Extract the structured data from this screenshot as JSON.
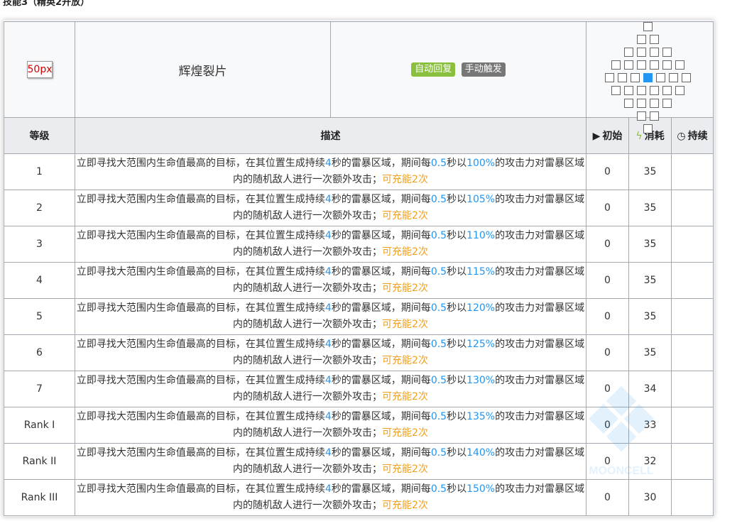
{
  "title": "技能3（精英2开放）",
  "skill": {
    "icon_alt": "50px",
    "name": "辉煌裂片",
    "tags": [
      {
        "label": "自动回复",
        "color": "#8ac03e"
      },
      {
        "label": "手动触发",
        "color": "#777777"
      }
    ],
    "range_icon": "range-grid-diamond"
  },
  "columns": {
    "level": "等级",
    "description": "描述",
    "initial": "初始",
    "initial_icon": "play-icon",
    "cost": "消耗",
    "cost_icon": "lightning-icon",
    "duration": "持续",
    "duration_icon": "clock-icon"
  },
  "description_parts": {
    "p1": "立即寻找大范围内生命值最高的目标，在其位置生成持续",
    "duration_sec": "4",
    "p2": "秒的雷暴区域，期间每",
    "interval": "0.5",
    "p3": "秒以",
    "p4": "的攻击力对雷暴区域内的随机敌人进行一次额外攻击；",
    "charges": "可充能2次"
  },
  "rows": [
    {
      "level": "1",
      "percent": "100%",
      "initial": "0",
      "cost": "35",
      "duration": ""
    },
    {
      "level": "2",
      "percent": "105%",
      "initial": "0",
      "cost": "35",
      "duration": ""
    },
    {
      "level": "3",
      "percent": "110%",
      "initial": "0",
      "cost": "35",
      "duration": ""
    },
    {
      "level": "4",
      "percent": "115%",
      "initial": "0",
      "cost": "35",
      "duration": ""
    },
    {
      "level": "5",
      "percent": "120%",
      "initial": "0",
      "cost": "35",
      "duration": ""
    },
    {
      "level": "6",
      "percent": "125%",
      "initial": "0",
      "cost": "35",
      "duration": ""
    },
    {
      "level": "7",
      "percent": "130%",
      "initial": "0",
      "cost": "34",
      "duration": ""
    },
    {
      "level": "Rank I",
      "percent": "135%",
      "initial": "0",
      "cost": "33",
      "duration": ""
    },
    {
      "level": "Rank II",
      "percent": "140%",
      "initial": "0",
      "cost": "32",
      "duration": ""
    },
    {
      "level": "Rank III",
      "percent": "150%",
      "initial": "0",
      "cost": "30",
      "duration": ""
    }
  ],
  "watermark": "MOONCELL",
  "colors": {
    "highlight_blue": "#2196f3",
    "highlight_orange": "#f0a020",
    "header_bg": "#eaecf0"
  }
}
